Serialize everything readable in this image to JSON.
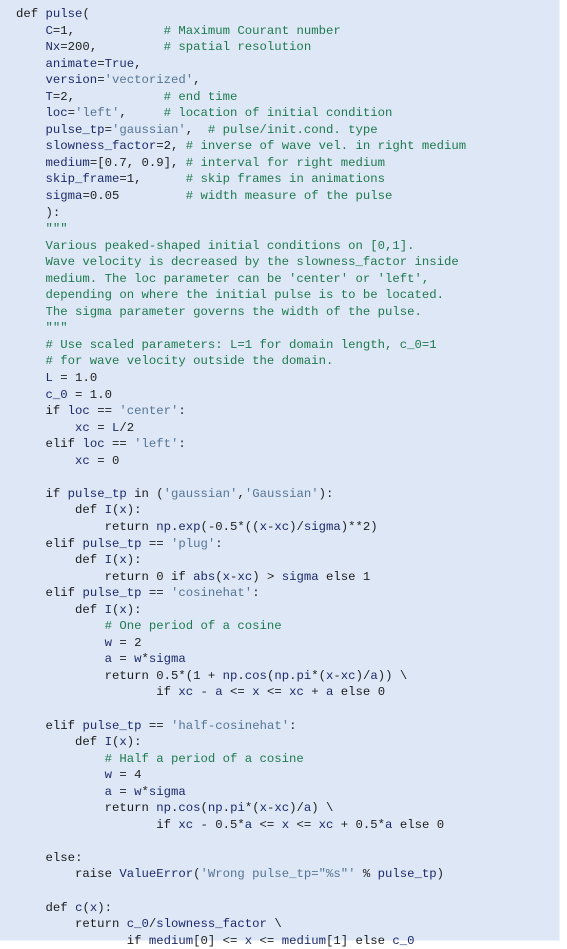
{
  "theme": {
    "background": "#dde7f5",
    "keyword_color": "#1a1a1a",
    "name_color": "#1c2a6b",
    "string_color": "#557595",
    "comment_color": "#1f7a4f"
  },
  "code": {
    "language": "python",
    "lines": [
      [
        [
          "kw",
          "def "
        ],
        [
          "nm",
          "pulse"
        ],
        [
          "pl",
          "("
        ]
      ],
      [
        [
          "pl",
          "    "
        ],
        [
          "nm",
          "C"
        ],
        [
          "pl",
          "=1,            "
        ],
        [
          "cm",
          "# Maximum Courant number"
        ]
      ],
      [
        [
          "pl",
          "    "
        ],
        [
          "nm",
          "Nx"
        ],
        [
          "pl",
          "=200,         "
        ],
        [
          "cm",
          "# spatial resolution"
        ]
      ],
      [
        [
          "pl",
          "    "
        ],
        [
          "nm",
          "animate"
        ],
        [
          "pl",
          "="
        ],
        [
          "nm",
          "True"
        ],
        [
          "pl",
          ","
        ]
      ],
      [
        [
          "pl",
          "    "
        ],
        [
          "nm",
          "version"
        ],
        [
          "pl",
          "="
        ],
        [
          "st",
          "'vectorized'"
        ],
        [
          "pl",
          ","
        ]
      ],
      [
        [
          "pl",
          "    "
        ],
        [
          "nm",
          "T"
        ],
        [
          "pl",
          "=2,            "
        ],
        [
          "cm",
          "# end time"
        ]
      ],
      [
        [
          "pl",
          "    "
        ],
        [
          "nm",
          "loc"
        ],
        [
          "pl",
          "="
        ],
        [
          "st",
          "'left'"
        ],
        [
          "pl",
          ",     "
        ],
        [
          "cm",
          "# location of initial condition"
        ]
      ],
      [
        [
          "pl",
          "    "
        ],
        [
          "nm",
          "pulse_tp"
        ],
        [
          "pl",
          "="
        ],
        [
          "st",
          "'gaussian'"
        ],
        [
          "pl",
          ",  "
        ],
        [
          "cm",
          "# pulse/init.cond. type"
        ]
      ],
      [
        [
          "pl",
          "    "
        ],
        [
          "nm",
          "slowness_factor"
        ],
        [
          "pl",
          "=2, "
        ],
        [
          "cm",
          "# inverse of wave vel. in right medium"
        ]
      ],
      [
        [
          "pl",
          "    "
        ],
        [
          "nm",
          "medium"
        ],
        [
          "pl",
          "=[0.7, 0.9], "
        ],
        [
          "cm",
          "# interval for right medium"
        ]
      ],
      [
        [
          "pl",
          "    "
        ],
        [
          "nm",
          "skip_frame"
        ],
        [
          "pl",
          "=1,      "
        ],
        [
          "cm",
          "# skip frames in animations"
        ]
      ],
      [
        [
          "pl",
          "    "
        ],
        [
          "nm",
          "sigma"
        ],
        [
          "pl",
          "=0.05         "
        ],
        [
          "cm",
          "# width measure of the pulse"
        ]
      ],
      [
        [
          "pl",
          "    ):"
        ]
      ],
      [
        [
          "pl",
          "    "
        ],
        [
          "ds",
          "\"\"\""
        ]
      ],
      [
        [
          "pl",
          "    "
        ],
        [
          "ds",
          "Various peaked-shaped initial conditions on [0,1]."
        ]
      ],
      [
        [
          "pl",
          "    "
        ],
        [
          "ds",
          "Wave velocity is decreased by the slowness_factor inside"
        ]
      ],
      [
        [
          "pl",
          "    "
        ],
        [
          "ds",
          "medium. The loc parameter can be 'center' or 'left',"
        ]
      ],
      [
        [
          "pl",
          "    "
        ],
        [
          "ds",
          "depending on where the initial pulse is to be located."
        ]
      ],
      [
        [
          "pl",
          "    "
        ],
        [
          "ds",
          "The sigma parameter governs the width of the pulse."
        ]
      ],
      [
        [
          "pl",
          "    "
        ],
        [
          "ds",
          "\"\"\""
        ]
      ],
      [
        [
          "pl",
          "    "
        ],
        [
          "cm",
          "# Use scaled parameters: L=1 for domain length, c_0=1"
        ]
      ],
      [
        [
          "pl",
          "    "
        ],
        [
          "cm",
          "# for wave velocity outside the domain."
        ]
      ],
      [
        [
          "pl",
          "    "
        ],
        [
          "nm",
          "L"
        ],
        [
          "pl",
          " = 1.0"
        ]
      ],
      [
        [
          "pl",
          "    "
        ],
        [
          "nm",
          "c_0"
        ],
        [
          "pl",
          " = 1.0"
        ]
      ],
      [
        [
          "pl",
          "    "
        ],
        [
          "kw",
          "if "
        ],
        [
          "nm",
          "loc"
        ],
        [
          "pl",
          " == "
        ],
        [
          "st",
          "'center'"
        ],
        [
          "pl",
          ":"
        ]
      ],
      [
        [
          "pl",
          "        "
        ],
        [
          "nm",
          "xc"
        ],
        [
          "pl",
          " = "
        ],
        [
          "nm",
          "L"
        ],
        [
          "pl",
          "/2"
        ]
      ],
      [
        [
          "pl",
          "    "
        ],
        [
          "kw",
          "elif "
        ],
        [
          "nm",
          "loc"
        ],
        [
          "pl",
          " == "
        ],
        [
          "st",
          "'left'"
        ],
        [
          "pl",
          ":"
        ]
      ],
      [
        [
          "pl",
          "        "
        ],
        [
          "nm",
          "xc"
        ],
        [
          "pl",
          " = 0"
        ]
      ],
      [
        [
          "pl",
          ""
        ]
      ],
      [
        [
          "pl",
          "    "
        ],
        [
          "kw",
          "if "
        ],
        [
          "nm",
          "pulse_tp"
        ],
        [
          "kw",
          " in "
        ],
        [
          "pl",
          "("
        ],
        [
          "st",
          "'gaussian'"
        ],
        [
          "pl",
          ","
        ],
        [
          "st",
          "'Gaussian'"
        ],
        [
          "pl",
          "):"
        ]
      ],
      [
        [
          "pl",
          "        "
        ],
        [
          "kw",
          "def "
        ],
        [
          "nm",
          "I"
        ],
        [
          "pl",
          "("
        ],
        [
          "nm",
          "x"
        ],
        [
          "pl",
          "):"
        ]
      ],
      [
        [
          "pl",
          "            "
        ],
        [
          "kw",
          "return "
        ],
        [
          "nm",
          "np"
        ],
        [
          "pl",
          "."
        ],
        [
          "nm",
          "exp"
        ],
        [
          "pl",
          "(-0.5*(("
        ],
        [
          "nm",
          "x"
        ],
        [
          "pl",
          "-"
        ],
        [
          "nm",
          "xc"
        ],
        [
          "pl",
          ")/"
        ],
        [
          "nm",
          "sigma"
        ],
        [
          "pl",
          ")**2)"
        ]
      ],
      [
        [
          "pl",
          "    "
        ],
        [
          "kw",
          "elif "
        ],
        [
          "nm",
          "pulse_tp"
        ],
        [
          "pl",
          " == "
        ],
        [
          "st",
          "'plug'"
        ],
        [
          "pl",
          ":"
        ]
      ],
      [
        [
          "pl",
          "        "
        ],
        [
          "kw",
          "def "
        ],
        [
          "nm",
          "I"
        ],
        [
          "pl",
          "("
        ],
        [
          "nm",
          "x"
        ],
        [
          "pl",
          "):"
        ]
      ],
      [
        [
          "pl",
          "            "
        ],
        [
          "kw",
          "return "
        ],
        [
          "pl",
          "0 "
        ],
        [
          "kw",
          "if "
        ],
        [
          "nm",
          "abs"
        ],
        [
          "pl",
          "("
        ],
        [
          "nm",
          "x"
        ],
        [
          "pl",
          "-"
        ],
        [
          "nm",
          "xc"
        ],
        [
          "pl",
          ") > "
        ],
        [
          "nm",
          "sigma"
        ],
        [
          "kw",
          " else "
        ],
        [
          "pl",
          "1"
        ]
      ],
      [
        [
          "pl",
          "    "
        ],
        [
          "kw",
          "elif "
        ],
        [
          "nm",
          "pulse_tp"
        ],
        [
          "pl",
          " == "
        ],
        [
          "st",
          "'cosinehat'"
        ],
        [
          "pl",
          ":"
        ]
      ],
      [
        [
          "pl",
          "        "
        ],
        [
          "kw",
          "def "
        ],
        [
          "nm",
          "I"
        ],
        [
          "pl",
          "("
        ],
        [
          "nm",
          "x"
        ],
        [
          "pl",
          "):"
        ]
      ],
      [
        [
          "pl",
          "            "
        ],
        [
          "cm",
          "# One period of a cosine"
        ]
      ],
      [
        [
          "pl",
          "            "
        ],
        [
          "nm",
          "w"
        ],
        [
          "pl",
          " = 2"
        ]
      ],
      [
        [
          "pl",
          "            "
        ],
        [
          "nm",
          "a"
        ],
        [
          "pl",
          " = "
        ],
        [
          "nm",
          "w"
        ],
        [
          "pl",
          "*"
        ],
        [
          "nm",
          "sigma"
        ]
      ],
      [
        [
          "pl",
          "            "
        ],
        [
          "kw",
          "return "
        ],
        [
          "pl",
          "0.5*(1 + "
        ],
        [
          "nm",
          "np"
        ],
        [
          "pl",
          "."
        ],
        [
          "nm",
          "cos"
        ],
        [
          "pl",
          "("
        ],
        [
          "nm",
          "np"
        ],
        [
          "pl",
          "."
        ],
        [
          "nm",
          "pi"
        ],
        [
          "pl",
          "*("
        ],
        [
          "nm",
          "x"
        ],
        [
          "pl",
          "-"
        ],
        [
          "nm",
          "xc"
        ],
        [
          "pl",
          ")/"
        ],
        [
          "nm",
          "a"
        ],
        [
          "pl",
          ")) \\"
        ]
      ],
      [
        [
          "pl",
          "                   "
        ],
        [
          "kw",
          "if "
        ],
        [
          "nm",
          "xc"
        ],
        [
          "pl",
          " - "
        ],
        [
          "nm",
          "a"
        ],
        [
          "pl",
          " <= "
        ],
        [
          "nm",
          "x"
        ],
        [
          "pl",
          " <= "
        ],
        [
          "nm",
          "xc"
        ],
        [
          "pl",
          " + "
        ],
        [
          "nm",
          "a"
        ],
        [
          "kw",
          " else "
        ],
        [
          "pl",
          "0"
        ]
      ],
      [
        [
          "pl",
          ""
        ]
      ],
      [
        [
          "pl",
          "    "
        ],
        [
          "kw",
          "elif "
        ],
        [
          "nm",
          "pulse_tp"
        ],
        [
          "pl",
          " == "
        ],
        [
          "st",
          "'half-cosinehat'"
        ],
        [
          "pl",
          ":"
        ]
      ],
      [
        [
          "pl",
          "        "
        ],
        [
          "kw",
          "def "
        ],
        [
          "nm",
          "I"
        ],
        [
          "pl",
          "("
        ],
        [
          "nm",
          "x"
        ],
        [
          "pl",
          "):"
        ]
      ],
      [
        [
          "pl",
          "            "
        ],
        [
          "cm",
          "# Half a period of a cosine"
        ]
      ],
      [
        [
          "pl",
          "            "
        ],
        [
          "nm",
          "w"
        ],
        [
          "pl",
          " = 4"
        ]
      ],
      [
        [
          "pl",
          "            "
        ],
        [
          "nm",
          "a"
        ],
        [
          "pl",
          " = "
        ],
        [
          "nm",
          "w"
        ],
        [
          "pl",
          "*"
        ],
        [
          "nm",
          "sigma"
        ]
      ],
      [
        [
          "pl",
          "            "
        ],
        [
          "kw",
          "return "
        ],
        [
          "nm",
          "np"
        ],
        [
          "pl",
          "."
        ],
        [
          "nm",
          "cos"
        ],
        [
          "pl",
          "("
        ],
        [
          "nm",
          "np"
        ],
        [
          "pl",
          "."
        ],
        [
          "nm",
          "pi"
        ],
        [
          "pl",
          "*("
        ],
        [
          "nm",
          "x"
        ],
        [
          "pl",
          "-"
        ],
        [
          "nm",
          "xc"
        ],
        [
          "pl",
          ")/"
        ],
        [
          "nm",
          "a"
        ],
        [
          "pl",
          ") \\"
        ]
      ],
      [
        [
          "pl",
          "                   "
        ],
        [
          "kw",
          "if "
        ],
        [
          "nm",
          "xc"
        ],
        [
          "pl",
          " - 0.5*"
        ],
        [
          "nm",
          "a"
        ],
        [
          "pl",
          " <= "
        ],
        [
          "nm",
          "x"
        ],
        [
          "pl",
          " <= "
        ],
        [
          "nm",
          "xc"
        ],
        [
          "pl",
          " + 0.5*"
        ],
        [
          "nm",
          "a"
        ],
        [
          "kw",
          " else "
        ],
        [
          "pl",
          "0"
        ]
      ],
      [
        [
          "pl",
          ""
        ]
      ],
      [
        [
          "pl",
          "    "
        ],
        [
          "kw",
          "else"
        ],
        [
          "pl",
          ":"
        ]
      ],
      [
        [
          "pl",
          "        "
        ],
        [
          "kw",
          "raise "
        ],
        [
          "nm",
          "ValueError"
        ],
        [
          "pl",
          "("
        ],
        [
          "st",
          "'Wrong pulse_tp=\"%s\"'"
        ],
        [
          "pl",
          " % "
        ],
        [
          "nm",
          "pulse_tp"
        ],
        [
          "pl",
          ")"
        ]
      ],
      [
        [
          "pl",
          ""
        ]
      ],
      [
        [
          "pl",
          "    "
        ],
        [
          "kw",
          "def "
        ],
        [
          "nm",
          "c"
        ],
        [
          "pl",
          "("
        ],
        [
          "nm",
          "x"
        ],
        [
          "pl",
          "):"
        ]
      ],
      [
        [
          "pl",
          "        "
        ],
        [
          "kw",
          "return "
        ],
        [
          "nm",
          "c_0"
        ],
        [
          "pl",
          "/"
        ],
        [
          "nm",
          "slowness_factor"
        ],
        [
          "pl",
          " \\"
        ]
      ],
      [
        [
          "pl",
          "               "
        ],
        [
          "kw",
          "if "
        ],
        [
          "nm",
          "medium"
        ],
        [
          "pl",
          "[0] <= "
        ],
        [
          "nm",
          "x"
        ],
        [
          "pl",
          " <= "
        ],
        [
          "nm",
          "medium"
        ],
        [
          "pl",
          "[1]"
        ],
        [
          "kw",
          " else "
        ],
        [
          "nm",
          "c_0"
        ]
      ]
    ]
  }
}
